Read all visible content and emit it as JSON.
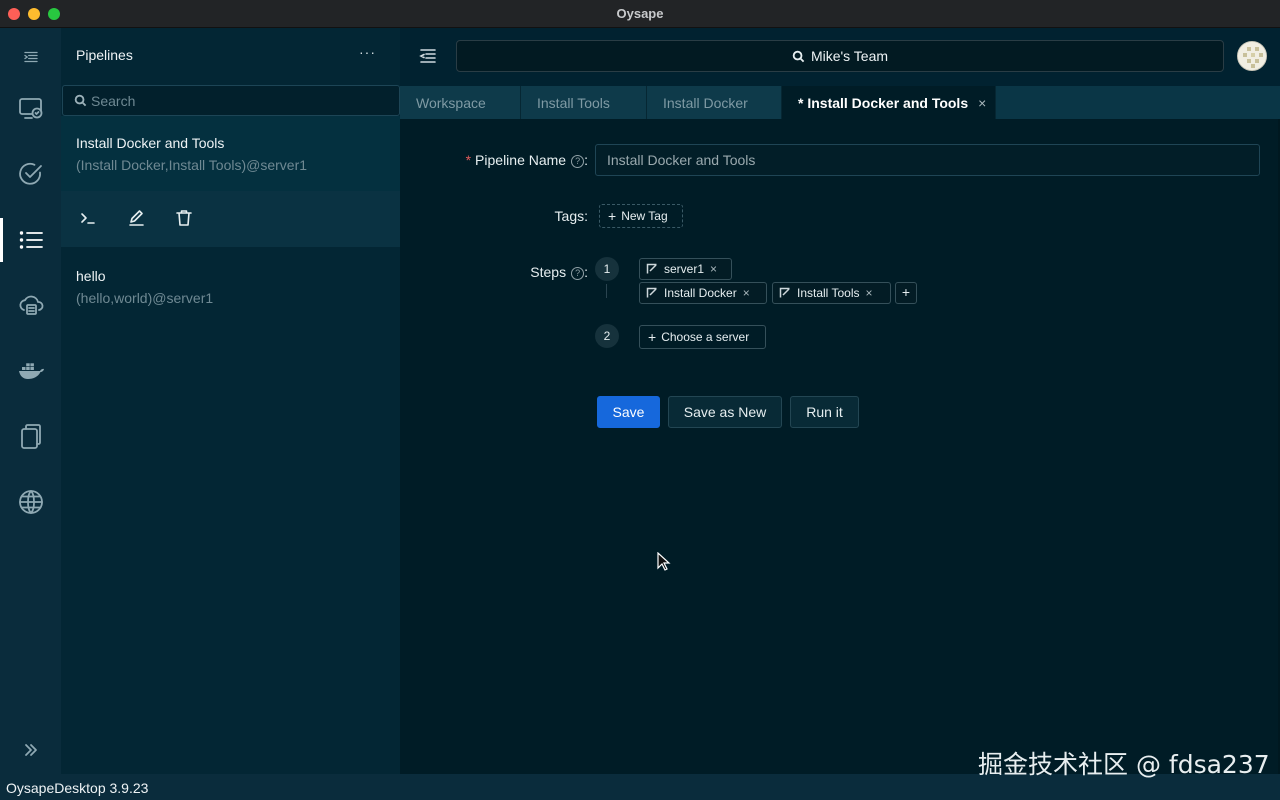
{
  "window": {
    "title": "Oysape"
  },
  "rail": {
    "items": [
      {
        "icon": "toggle-panel-icon"
      },
      {
        "icon": "server-monitor-icon"
      },
      {
        "icon": "task-check-icon"
      },
      {
        "icon": "pipeline-list-icon",
        "active": true
      },
      {
        "icon": "cloud-server-icon"
      },
      {
        "icon": "docker-icon"
      },
      {
        "icon": "files-icon"
      },
      {
        "icon": "globe-icon"
      }
    ],
    "collapse_icon": "double-chevron-right-icon"
  },
  "sidebar": {
    "title": "Pipelines",
    "more_label": "···",
    "search_placeholder": "Search",
    "pipelines": [
      {
        "name": "Install Docker and Tools",
        "detail": "(Install Docker,Install Tools)@server1",
        "selected": true
      },
      {
        "name": "hello",
        "detail": "(hello,world)@server1",
        "selected": false
      }
    ],
    "actions": [
      "terminal-icon",
      "edit-icon",
      "delete-icon"
    ]
  },
  "header": {
    "team_label": "Mike's Team"
  },
  "tabs": [
    {
      "label": "Workspace",
      "active": false
    },
    {
      "label": "Install Tools",
      "active": false
    },
    {
      "label": "Install Docker",
      "active": false
    },
    {
      "label": "* Install Docker and Tools",
      "active": true,
      "close": "×"
    }
  ],
  "form": {
    "name_label": "Pipeline Name",
    "name_required_mark": "*",
    "help_mark": "?",
    "name_value": "Install Docker and Tools",
    "tags_label": "Tags",
    "new_tag_label": "New Tag",
    "steps_label": "Steps",
    "steps": [
      {
        "number": "1",
        "server": "server1",
        "tasks": [
          "Install Docker",
          "Install Tools"
        ]
      },
      {
        "number": "2",
        "choose_server_label": "Choose a server"
      }
    ],
    "add_task_label": "+",
    "chip_remove": "×",
    "colon": ":"
  },
  "buttons": {
    "save": "Save",
    "save_as_new": "Save as New",
    "run": "Run it"
  },
  "status": {
    "version": "OysapeDesktop 3.9.23"
  },
  "watermark": "掘金技术社区 @ fdsa237",
  "colors": {
    "accent": "#1668dc",
    "background": "#001c26",
    "panel": "#032634",
    "rail": "#0a2c3c"
  }
}
